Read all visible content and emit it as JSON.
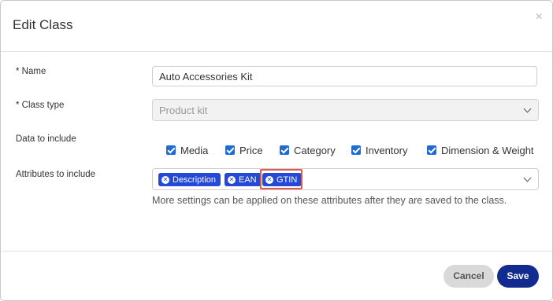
{
  "dialog": {
    "title": "Edit Class",
    "close_glyph": "×"
  },
  "form": {
    "name": {
      "label": "* Name",
      "value": "Auto Accessories Kit"
    },
    "class_type": {
      "label": "* Class type",
      "value": "Product kit"
    },
    "data_to_include": {
      "label": "Data to include",
      "options": [
        {
          "label": "Media",
          "checked": true
        },
        {
          "label": "Price",
          "checked": true
        },
        {
          "label": "Category",
          "checked": true
        },
        {
          "label": "Inventory",
          "checked": true
        },
        {
          "label": "Dimension & Weight",
          "checked": true
        }
      ]
    },
    "attributes": {
      "label": "Attributes to include",
      "tags": [
        "Description",
        "EAN",
        "GTIN"
      ],
      "hint": "More settings can be applied on these attributes after they are saved to the class."
    }
  },
  "footer": {
    "cancel_label": "Cancel",
    "save_label": "Save"
  },
  "colors": {
    "accent": "#1e6bd6",
    "tag": "#2449d8",
    "save": "#122b8f",
    "highlight": "#e0584a"
  }
}
